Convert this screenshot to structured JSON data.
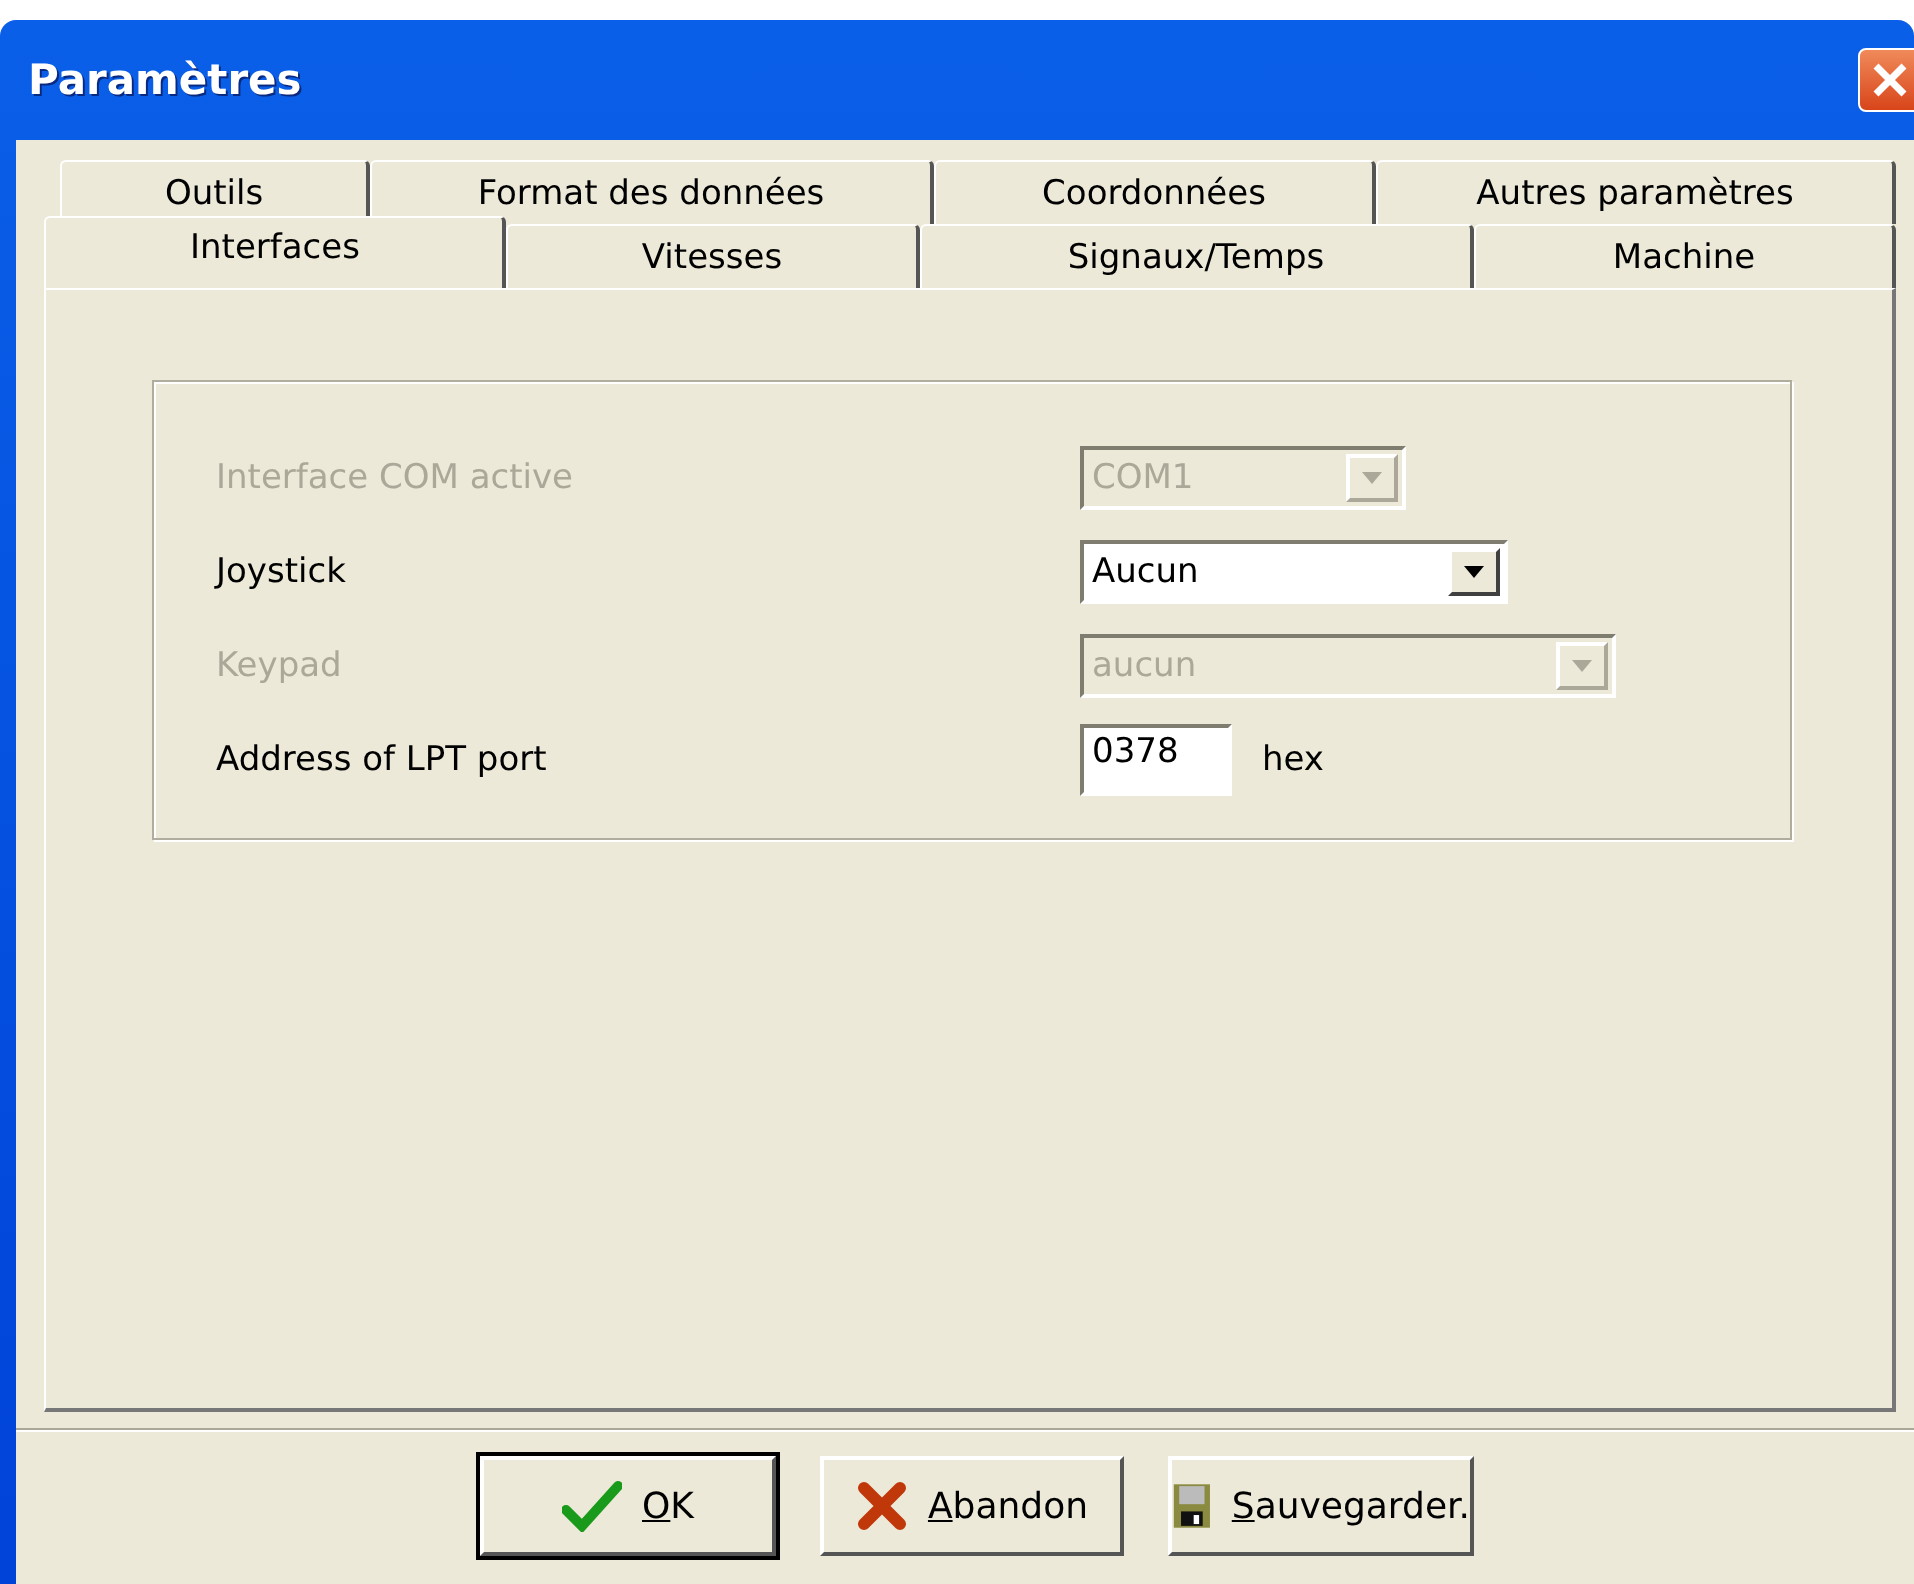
{
  "window": {
    "title": "Paramètres"
  },
  "tab_rows": [
    [
      {
        "label": "Outils",
        "selected": false
      },
      {
        "label": "Format des données",
        "selected": false
      },
      {
        "label": "Coordonnées",
        "selected": false
      },
      {
        "label": "Autres paramètres",
        "selected": false
      }
    ],
    [
      {
        "label": "Interfaces",
        "selected": true
      },
      {
        "label": "Vitesses",
        "selected": false
      },
      {
        "label": "Signaux/Temps",
        "selected": false
      },
      {
        "label": "Machine",
        "selected": false
      }
    ]
  ],
  "settings": [
    {
      "kind": "combo",
      "label": "Interface COM active",
      "value": "COM1",
      "disabled": true
    },
    {
      "kind": "combo",
      "label": "Joystick",
      "value": "Aucun",
      "disabled": false
    },
    {
      "kind": "combo",
      "label": "Keypad",
      "value": "aucun",
      "disabled": true
    },
    {
      "kind": "text",
      "label": "Address of LPT port",
      "value": "0378",
      "unit": "hex",
      "disabled": false
    }
  ],
  "buttons": [
    {
      "kind": "ok",
      "label": "OK",
      "default": true,
      "underlined_first_letter": true
    },
    {
      "kind": "cancel",
      "label": "Abandon",
      "default": false,
      "underlined_first_letter": true
    },
    {
      "kind": "save",
      "label": "Sauvegarder.",
      "default": false,
      "underlined_first_letter": true
    }
  ]
}
